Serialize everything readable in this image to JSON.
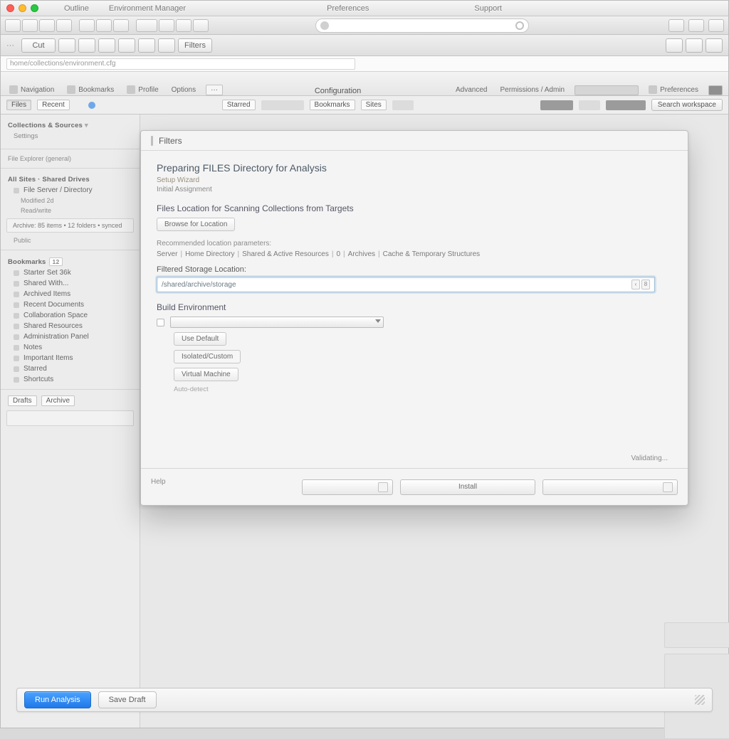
{
  "titlebar": {
    "app": "Outline",
    "doc": "Environment Manager",
    "menu1": "Preferences",
    "menu2": "Support"
  },
  "toolbar2": {
    "btn_cut": "Cut",
    "btn_filters": "Filters"
  },
  "addrbar": {
    "path": "home/collections/environment.cfg"
  },
  "ribbon": {
    "left1": "Navigation",
    "left2": "Bookmarks",
    "left3": "Profile",
    "left4": "Options",
    "center": "Configuration",
    "r1": "Advanced",
    "r2": "Permissions / Admin",
    "r3": "Preferences"
  },
  "filters": {
    "c1": "Files",
    "c2": "Recent",
    "c3": "Starred",
    "c4": "Bookmarks",
    "c5": "Sites",
    "search": "Search workspace"
  },
  "sidebar": {
    "h1": "Collections & Sources",
    "h1b": "Settings",
    "sub1": "File Explorer (general)",
    "h2": "All Sites · Shared Drives",
    "items2": [
      "File Server / Directory"
    ],
    "meta1": "Modified 2d",
    "meta2": "Read/write",
    "block1": "Archive: 85 items • 12 folders • synced",
    "block2": "Public",
    "h3": "Bookmarks",
    "badge3": "12",
    "items3": [
      "Starter Set  36k",
      "Shared With...",
      "Archived Items",
      "Recent Documents",
      "Collaboration Space",
      "Shared Resources",
      "Administration Panel",
      "Notes",
      "Important Items",
      "Starred",
      "Shortcuts"
    ],
    "ftags": [
      "Drafts",
      "Archive"
    ]
  },
  "modal": {
    "header": "Filters",
    "title": "Preparing FILES Directory for Analysis",
    "sub": "Setup Wizard",
    "sub2": "Initial Assignment",
    "section1": "Files Location for Scanning Collections from Targets",
    "btn_browse": "Browse for Location",
    "small1": "Recommended location parameters:",
    "crumbs": [
      "Server",
      "Home Directory",
      "Shared & Active Resources",
      "0",
      "Archives",
      "Cache & Temporary Structures"
    ],
    "label1": "Filtered Storage Location:",
    "input_value": "/shared/archive/storage",
    "pg_prev": "‹",
    "pg_badge": "8",
    "env_h": "Build Environment",
    "env_opt1": "Use Default",
    "env_opt2": "Isolated/Custom",
    "env_opt3": "Virtual Machine",
    "env_note": "Auto-detect",
    "ft_link": "Help",
    "status": "Validating...",
    "ft_btn2": "Install"
  },
  "bottom": {
    "primary": "Run Analysis",
    "secondary": "Save Draft"
  }
}
